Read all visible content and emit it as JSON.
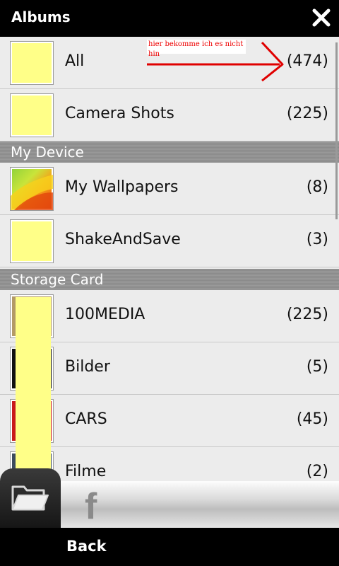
{
  "header": {
    "title": "Albums"
  },
  "annotation": {
    "text": "hier bekomme ich es nicht hin"
  },
  "albums_top": [
    {
      "name": "All",
      "count": "(474)"
    },
    {
      "name": "Camera Shots",
      "count": "(225)"
    }
  ],
  "sections": [
    {
      "title": "My Device",
      "items": [
        {
          "name": "My Wallpapers",
          "count": "(8)"
        },
        {
          "name": "ShakeAndSave",
          "count": "(3)"
        }
      ]
    },
    {
      "title": "Storage Card",
      "items": [
        {
          "name": "100MEDIA",
          "count": "(225)"
        },
        {
          "name": "Bilder",
          "count": "(5)"
        },
        {
          "name": "CARS",
          "count": "(45)"
        },
        {
          "name": "Filme",
          "count": "(2)"
        }
      ]
    }
  ],
  "footer": {
    "back_label": "Back"
  },
  "colors": {
    "thumb_fill": "#ffff88",
    "annotation_red": "#e00000"
  },
  "icons": [
    "close-icon",
    "folder-icon",
    "facebook-icon"
  ]
}
